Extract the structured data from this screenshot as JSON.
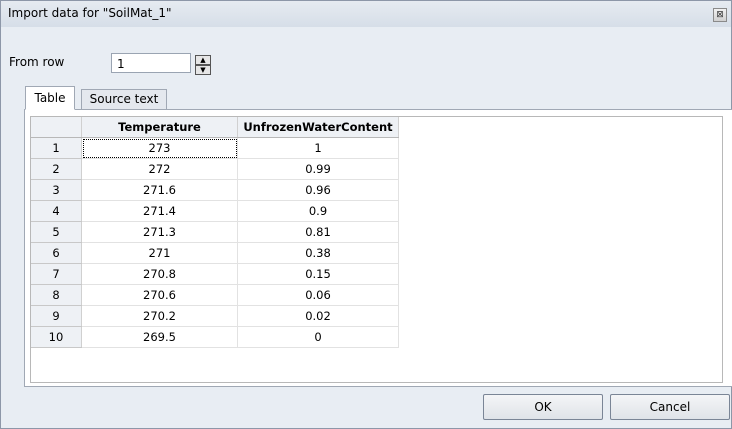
{
  "window": {
    "title": "Import data for \"SoilMat_1\"",
    "close_glyph": "⊠"
  },
  "from_row": {
    "label": "From row",
    "value": "1"
  },
  "tabs": [
    {
      "label": "Table",
      "active": true
    },
    {
      "label": "Source text",
      "active": false
    }
  ],
  "table": {
    "columns": [
      "Temperature",
      "UnfrozenWaterContent"
    ],
    "rows": [
      {
        "n": "1",
        "temperature": "273",
        "water": "1"
      },
      {
        "n": "2",
        "temperature": "272",
        "water": "0.99"
      },
      {
        "n": "3",
        "temperature": "271.6",
        "water": "0.96"
      },
      {
        "n": "4",
        "temperature": "271.4",
        "water": "0.9"
      },
      {
        "n": "5",
        "temperature": "271.3",
        "water": "0.81"
      },
      {
        "n": "6",
        "temperature": "271",
        "water": "0.38"
      },
      {
        "n": "7",
        "temperature": "270.8",
        "water": "0.15"
      },
      {
        "n": "8",
        "temperature": "270.6",
        "water": "0.06"
      },
      {
        "n": "9",
        "temperature": "270.2",
        "water": "0.02"
      },
      {
        "n": "10",
        "temperature": "269.5",
        "water": "0"
      }
    ]
  },
  "buttons": {
    "ok": "OK",
    "cancel": "Cancel"
  }
}
